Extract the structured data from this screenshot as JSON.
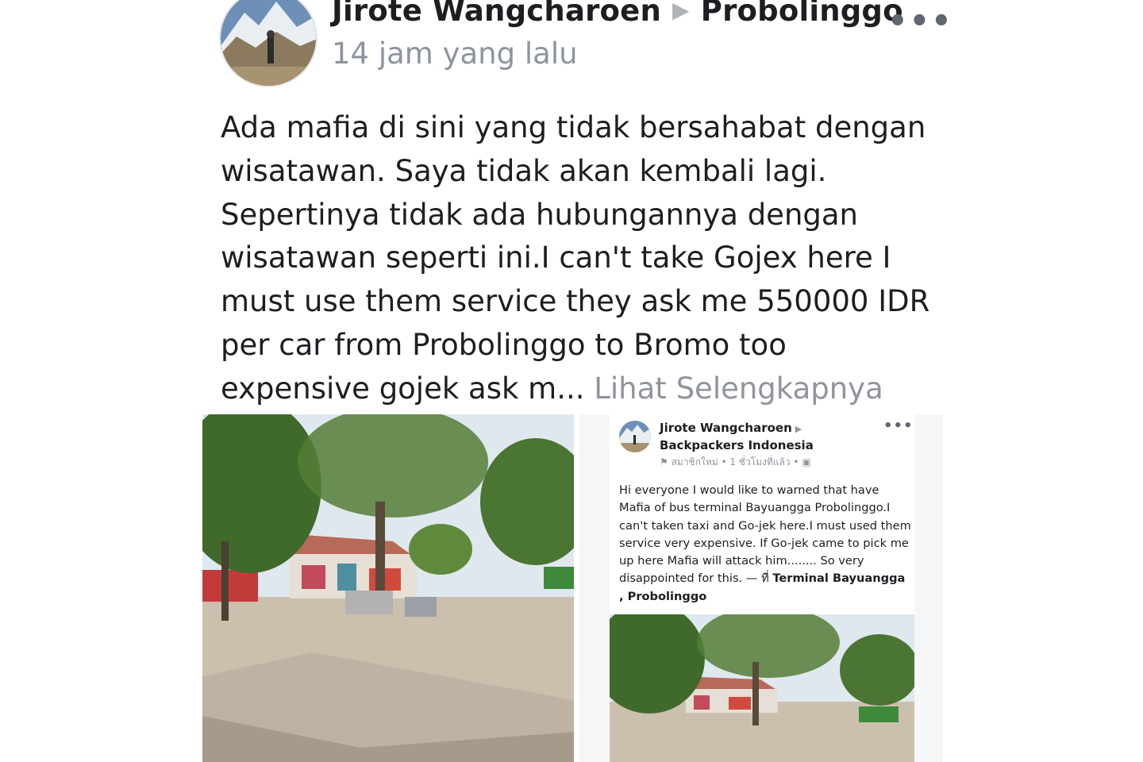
{
  "post": {
    "author": "Jirote Wangcharoen",
    "arrow": "▶",
    "place": "Probolinggo",
    "timestamp": "14 jam yang lalu",
    "more_icon": "more-horizontal-icon",
    "more_glyph": "•••",
    "text": "Ada mafia di sini yang tidak bersahabat dengan wisatawan. Saya tidak akan kembali lagi. Sepertinya tidak ada hubungannya dengan wisatawan seperti ini.I can't take Gojex here I must use them service they ask me 550000 IDR per car from Probolinggo to Bromo too expensive gojek ask m...",
    "see_more": "Lihat Selengkapnya"
  },
  "shared_post": {
    "author": "Jirote Wangcharoen",
    "arrow": "▶",
    "group": "Backpackers Indonesia",
    "meta": "สมาชิกใหม่ • 1 ชั่วโมงที่แล้ว •",
    "more_glyph": "•••",
    "text": "Hi everyone I would like to warned that have Mafia of bus terminal Bayuangga Probolinggo.I can't taken taxi and Go-jek here.I must used them service very expensive. If Go-jek came to pick me up here Mafia will attack him........ So very disappointed for this. — ที่",
    "location": "Terminal Bayuangga , Probolinggo"
  },
  "colors": {
    "text": "#1c1e21",
    "secondary": "#8d949e",
    "see_more": "#90949c",
    "sky": "#dfe8ee",
    "ground": "#cbbfae",
    "foliage": "#3f6a2b",
    "roof": "#b86a58"
  }
}
